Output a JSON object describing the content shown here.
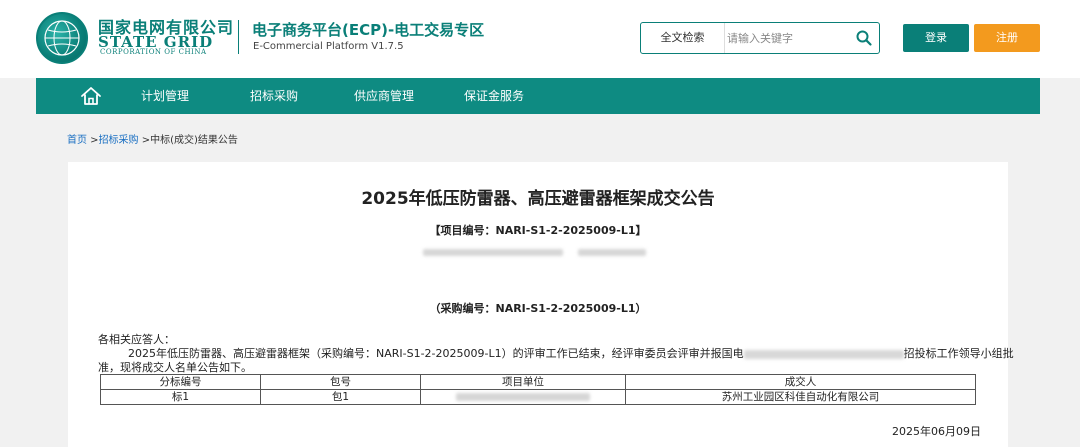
{
  "header": {
    "company_cn": "国家电网有限公司",
    "company_en": "STATE GRID",
    "company_en_sub": "CORPORATION OF CHINA",
    "platform_title": "电子商务平台(ECP)-电工交易专区",
    "platform_sub": "E-Commercial Platform V1.7.5",
    "search": {
      "scope": "全文检索",
      "placeholder": "请输入关键字"
    },
    "login_label": "登录",
    "register_label": "注册"
  },
  "nav": {
    "items": [
      {
        "label": "计划管理"
      },
      {
        "label": "招标采购"
      },
      {
        "label": "供应商管理"
      },
      {
        "label": "保证金服务"
      }
    ]
  },
  "breadcrumb": {
    "home": "首页",
    "sep": " >",
    "level1": "招标采购",
    "current": "中标(成交)结果公告"
  },
  "notice": {
    "title": "2025年低压防雷器、高压避雷器框架成交公告",
    "project_no": "【项目编号：NARI-S1-2-2025009-L1】",
    "purchase_no": "（采购编号：NARI-S1-2-2025009-L1）",
    "salutation": "各相关应答人：",
    "paragraph_line1_a": "2025年低压防雷器、高压避雷器框架（采购编号：NARI-S1-2-2025009-L1）的评审工作已结束，经评审委员会评审并报国电",
    "paragraph_line1_b": "招投标工作领导小组批",
    "paragraph_line2": "准，现将成交人名单公告如下。",
    "table": {
      "headers": [
        "分标编号",
        "包号",
        "项目单位",
        "成交人"
      ],
      "rows": [
        {
          "lot": "标1",
          "package": "包1",
          "winner": "苏州工业园区科佳自动化有限公司"
        }
      ]
    },
    "date": "2025年06月09日"
  },
  "colors": {
    "brand_green": "#0a7f78",
    "nav_green": "#0e8b82",
    "register_orange": "#f39a1e",
    "link_blue": "#1a6fc2"
  }
}
